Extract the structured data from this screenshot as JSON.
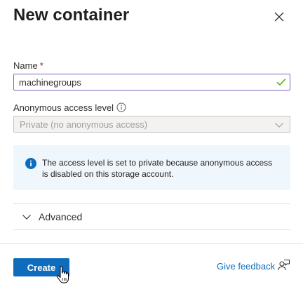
{
  "panel": {
    "title": "New container",
    "close_icon": "close-icon"
  },
  "name_field": {
    "label": "Name",
    "required_marker": "*",
    "value": "machinegroups",
    "valid_icon": "checkmark-icon"
  },
  "access_level": {
    "label": "Anonymous access level",
    "info_icon": "info-icon",
    "selected": "Private (no anonymous access)",
    "disabled": true
  },
  "info_message": {
    "icon": "info-filled-icon",
    "text": "The access level is set to private because anonymous access is disabled on this storage account."
  },
  "advanced": {
    "label": "Advanced",
    "expanded": false
  },
  "footer": {
    "create_label": "Create",
    "feedback_label": "Give feedback",
    "feedback_icon": "feedback-person-icon"
  },
  "colors": {
    "primary": "#0f6cbd",
    "input_focus_border": "#8764b8",
    "valid_check": "#57a300",
    "info_bg": "#eff6fc",
    "required": "#a4262c"
  }
}
